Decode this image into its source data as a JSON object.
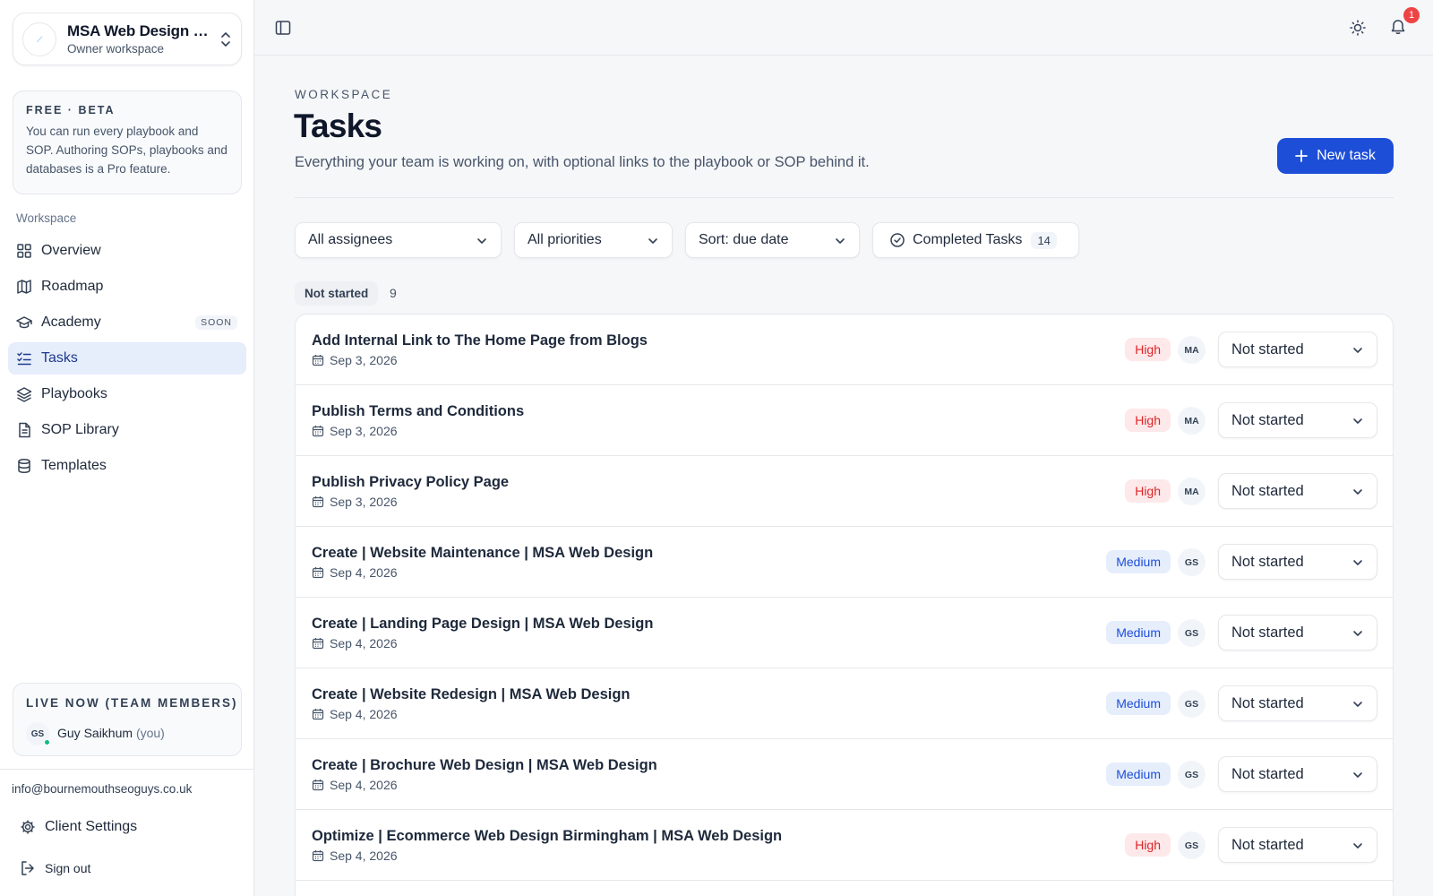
{
  "workspace": {
    "name": "MSA Web Design B...",
    "role": "Owner workspace",
    "logo_text": "⟋"
  },
  "beta": {
    "title": "FREE · BETA",
    "text": "You can run every playbook and SOP. Authoring SOPs, playbooks and databases is a Pro feature."
  },
  "nav": {
    "section_label": "Workspace",
    "items": [
      {
        "label": "Overview",
        "icon": "grid-icon"
      },
      {
        "label": "Roadmap",
        "icon": "map-icon"
      },
      {
        "label": "Academy",
        "icon": "graduation-cap-icon",
        "badge": "SOON"
      },
      {
        "label": "Tasks",
        "icon": "list-checks-icon",
        "active": true
      },
      {
        "label": "Playbooks",
        "icon": "layers-icon"
      },
      {
        "label": "SOP Library",
        "icon": "file-text-icon"
      },
      {
        "label": "Templates",
        "icon": "database-icon"
      }
    ]
  },
  "live": {
    "title": "LIVE NOW (TEAM MEMBERS)",
    "member_initials": "GS",
    "member_name": "Guy Saikhum",
    "member_you": "(you)"
  },
  "account": {
    "email": "info@bournemouthseoguys.co.uk",
    "settings_label": "Client Settings",
    "signout_label": "Sign out"
  },
  "header": {
    "notifications_count": "1"
  },
  "page": {
    "eyebrow": "WORKSPACE",
    "title": "Tasks",
    "subtitle": "Everything your team is working on, with optional links to the playbook or SOP behind it.",
    "new_task_label": "New task"
  },
  "filters": {
    "assignees": "All assignees",
    "priorities": "All priorities",
    "sort": "Sort: due date",
    "completed_label": "Completed Tasks",
    "completed_count": "14"
  },
  "group": {
    "label": "Not started",
    "count": "9"
  },
  "tasks": [
    {
      "title": "Add Internal Link to The Home Page from Blogs",
      "date": "Sep 3, 2026",
      "priority": "High",
      "assignee": "MA",
      "status": "Not started"
    },
    {
      "title": "Publish Terms and Conditions",
      "date": "Sep 3, 2026",
      "priority": "High",
      "assignee": "MA",
      "status": "Not started"
    },
    {
      "title": "Publish Privacy Policy Page",
      "date": "Sep 3, 2026",
      "priority": "High",
      "assignee": "MA",
      "status": "Not started"
    },
    {
      "title": "Create | Website Maintenance | MSA Web Design",
      "date": "Sep 4, 2026",
      "priority": "Medium",
      "assignee": "GS",
      "status": "Not started"
    },
    {
      "title": "Create | Landing Page Design | MSA Web Design",
      "date": "Sep 4, 2026",
      "priority": "Medium",
      "assignee": "GS",
      "status": "Not started"
    },
    {
      "title": "Create | Website Redesign | MSA Web Design",
      "date": "Sep 4, 2026",
      "priority": "Medium",
      "assignee": "GS",
      "status": "Not started"
    },
    {
      "title": "Create | Brochure Web Design | MSA Web Design",
      "date": "Sep 4, 2026",
      "priority": "Medium",
      "assignee": "GS",
      "status": "Not started"
    },
    {
      "title": "Optimize | Ecommerce Web Design Birmingham | MSA Web Design",
      "date": "Sep 4, 2026",
      "priority": "High",
      "assignee": "GS",
      "status": "Not started"
    }
  ],
  "colors": {
    "accent": "#1d4ed8",
    "high_bg": "#fde8ea",
    "high_fg": "#dc2626",
    "medium_bg": "#e6eefc",
    "medium_fg": "#1d4ed8",
    "live_dot": "#10b981",
    "badge": "#ef4444"
  }
}
